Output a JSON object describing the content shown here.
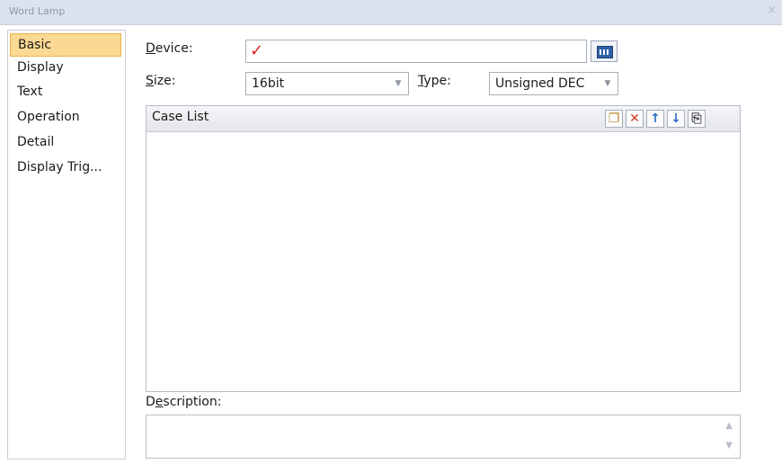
{
  "window": {
    "title": "Word Lamp",
    "close_glyph": "×"
  },
  "sidebar": {
    "items": [
      {
        "label": "Basic",
        "selected": true
      },
      {
        "label": "Display",
        "selected": false
      },
      {
        "label": "Text",
        "selected": false
      },
      {
        "label": "Operation",
        "selected": false
      },
      {
        "label": "Detail",
        "selected": false
      },
      {
        "label": "Display Trig...",
        "selected": false
      }
    ]
  },
  "form": {
    "device": {
      "label_mnemonic": "D",
      "label_rest": "evice:",
      "value": "",
      "status_glyph": "✓",
      "browse_icon": "device-browse-icon"
    },
    "size": {
      "label_mnemonic": "S",
      "label_rest": "ize:",
      "value": "16bit"
    },
    "type": {
      "label_mnemonic": "T",
      "label_rest": "ype:",
      "value": "Unsigned DEC"
    },
    "dropdown_glyph": "▼"
  },
  "case_list": {
    "header": "Case List",
    "toolbar": [
      {
        "name": "add-case-icon",
        "glyph": "❐",
        "color": "#c08a2a"
      },
      {
        "name": "delete-case-icon",
        "glyph": "✕",
        "color": "#d23a1c"
      },
      {
        "name": "move-up-icon",
        "glyph": "↑",
        "color": "#2e6cc4"
      },
      {
        "name": "move-down-icon",
        "glyph": "↓",
        "color": "#2e6cc4"
      },
      {
        "name": "copy-case-icon",
        "glyph": "⎘",
        "color": "#4a4f57"
      }
    ],
    "rows": []
  },
  "description": {
    "label_pre": "D",
    "label_mnemonic": "e",
    "label_rest": "scription:",
    "value": "",
    "scroll_up": "▲",
    "scroll_down": "▼"
  },
  "colors": {
    "selected_bg": "#fbd993",
    "selected_border": "#e7b44d",
    "titlebar": "#dde3ee"
  }
}
